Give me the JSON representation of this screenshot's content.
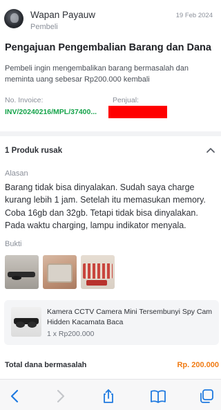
{
  "header": {
    "user_name": "Wapan Payauw",
    "user_role": "Pembeli",
    "date": "19 Feb 2024"
  },
  "page_title": "Pengajuan Pengembalian Barang dan Dana",
  "description": "Pembeli ingin mengembalikan barang bermasalah dan meminta uang sebesar Rp200.000 kembali",
  "invoice": {
    "label": "No. Invoice:",
    "value": "INV/20240216/MPL/37400..."
  },
  "seller": {
    "label": "Penjual:",
    "value": ""
  },
  "product_section": {
    "header": "1 Produk rusak",
    "reason_label": "Alasan",
    "reason_text": "Barang tidak bisa dinyalakan. Sudah saya charge kurang lebih 1 jam. Setelah itu memasukan memory. Coba 16gb dan 32gb. Tetapi tidak bisa dinyalakan. Pada waktu charging, lampu indikator menyala.",
    "proof_label": "Bukti"
  },
  "product_card": {
    "name": "Kamera CCTV Camera Mini Tersembunyi Spy Cam Hidden Kacamata Baca",
    "qty_price": "1 x Rp200.000"
  },
  "total": {
    "label": "Total dana bermasalah",
    "value": "Rp. 200.000"
  },
  "icons": {
    "back": "chevron-left-icon",
    "forward": "chevron-right-icon",
    "share": "share-icon",
    "bookmarks": "book-icon",
    "tabs": "tabs-icon",
    "collapse": "chevron-up-icon"
  },
  "colors": {
    "accent_green": "#15a34a",
    "price_orange": "#f07a12",
    "redaction": "#ff0000",
    "ios_blue": "#1f7ae0"
  }
}
